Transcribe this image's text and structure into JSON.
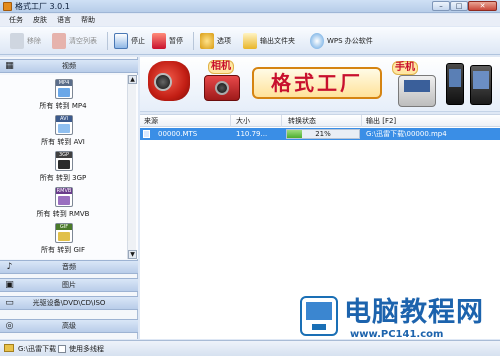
{
  "window": {
    "title": "格式工厂 3.0.1",
    "controls": {
      "minimize": "–",
      "maximize": "□",
      "close": "✕"
    }
  },
  "menu": [
    "任务",
    "皮肤",
    "语言",
    "帮助"
  ],
  "toolbar": {
    "remove": "移除",
    "clear_list": "清空列表",
    "stop": "停止",
    "pause": "暂停",
    "options": "选项",
    "output_folder": "输出文件夹",
    "wps": "WPS 办公软件"
  },
  "sidebar": {
    "video_header": "视频",
    "video_items": [
      {
        "label": "所有 转到 MP4",
        "tag": "MP4"
      },
      {
        "label": "所有 转到 AVI",
        "tag": "AVI"
      },
      {
        "label": "所有 转到 3GP",
        "tag": "3GP"
      },
      {
        "label": "所有 转到 RMVB",
        "tag": "RMVB"
      },
      {
        "label": "所有 转到 GIF",
        "tag": "GIF"
      }
    ],
    "audio_header": "音频",
    "picture_header": "图片",
    "disc_header": "光驱设备\\DVD\\CD\\ISO",
    "advanced_header": "高级"
  },
  "banner": {
    "bubble_left": "相机",
    "brand": "格式工厂",
    "bubble_right": "手机"
  },
  "table": {
    "headers": [
      "来源",
      "大小",
      "转换状态",
      "输出 [F2]"
    ],
    "rows": [
      {
        "source": "00000.MTS",
        "size": "110.79...",
        "status_percent": 21,
        "status_label": "21%",
        "output": "G:\\迅雷下载\\00000.mp4"
      }
    ]
  },
  "statusbar": {
    "folder": "G:\\迅雷下载",
    "multithread_label": "使用多线程"
  },
  "watermark": {
    "title": "电脑教程网",
    "url": "www.PC141.com"
  },
  "colors": {
    "selection": "#3a8ee6",
    "progress": "#4dae2f",
    "watermark": "#1c63ad"
  }
}
